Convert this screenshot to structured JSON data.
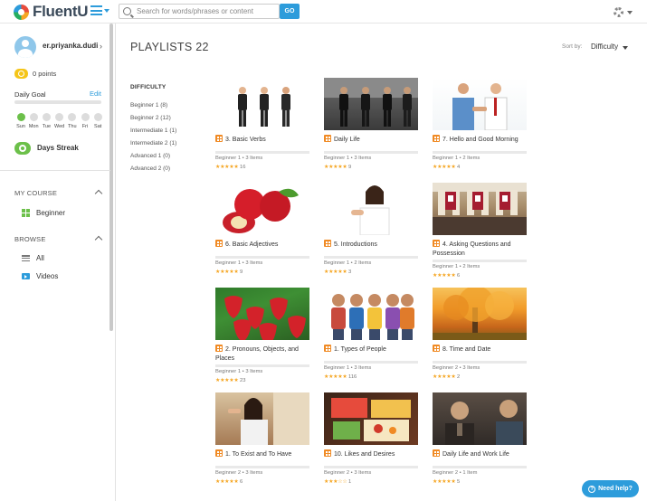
{
  "app": {
    "name": "FluentU"
  },
  "search": {
    "placeholder": "Search for words/phrases or content",
    "go_label": "GO"
  },
  "sidebar": {
    "username": "er.priyanka.dudi",
    "points": "0 points",
    "daily_goal_label": "Daily Goal",
    "edit_label": "Edit",
    "goal_progress": 0,
    "days": [
      "Sun",
      "Mon",
      "Tue",
      "Wed",
      "Thu",
      "Fri",
      "Sat"
    ],
    "active_day_index": 0,
    "streak_label": "Days Streak",
    "my_course_label": "MY COURSE",
    "course_item": "Beginner",
    "browse_label": "BROWSE",
    "browse_items": [
      "All",
      "Videos"
    ]
  },
  "main": {
    "title": "PLAYLISTS 22",
    "sort_label": "Sort by:",
    "sort_value": "Difficulty",
    "filters": {
      "heading": "DIFFICULTY",
      "items": [
        "Beginner 1 (8)",
        "Beginner 2 (12)",
        "Intermediate 1 (1)",
        "Intermediate 2 (1)",
        "Advanced 1 (0)",
        "Advanced 2 (0)"
      ]
    },
    "cards": [
      {
        "title": "3. Basic Verbs",
        "level": "Beginner 1",
        "items": "3 Items",
        "rating": 5,
        "reviews": "16"
      },
      {
        "title": "Daily Life",
        "level": "Beginner 1",
        "items": "3 Items",
        "rating": 5,
        "reviews": "9"
      },
      {
        "title": "7. Hello and Good Morning",
        "level": "Beginner 1",
        "items": "2 Items",
        "rating": 5,
        "reviews": "4"
      },
      {
        "title": "6. Basic Adjectives",
        "level": "Beginner 1",
        "items": "3 Items",
        "rating": 5,
        "reviews": "9"
      },
      {
        "title": "5. Introductions",
        "level": "Beginner 1",
        "items": "2 Items",
        "rating": 5,
        "reviews": "3"
      },
      {
        "title": "4. Asking Questions and Possession",
        "level": "Beginner 1",
        "items": "2 Items",
        "rating": 5,
        "reviews": "6"
      },
      {
        "title": "2. Pronouns, Objects, and Places",
        "level": "Beginner 1",
        "items": "3 Items",
        "rating": 5,
        "reviews": "23"
      },
      {
        "title": "1. Types of People",
        "level": "Beginner 1",
        "items": "3 Items",
        "rating": 5,
        "reviews": "116"
      },
      {
        "title": "8. Time and Date",
        "level": "Beginner 2",
        "items": "3 Items",
        "rating": 5,
        "reviews": "2"
      },
      {
        "title": "1. To Exist and To Have",
        "level": "Beginner 2",
        "items": "3 Items",
        "rating": 5,
        "reviews": "6"
      },
      {
        "title": "10. Likes and Desires",
        "level": "Beginner 2",
        "items": "3 Items",
        "rating": 3,
        "reviews": "1"
      },
      {
        "title": "Daily Life and Work Life",
        "level": "Beginner 2",
        "items": "1 Item",
        "rating": 5,
        "reviews": "5"
      }
    ]
  },
  "help": {
    "label": "Need help?"
  },
  "colors": {
    "brand": "#2d9cdb",
    "accent_green": "#6cc04a",
    "card_icon": "#f08a24",
    "star": "#f5a623"
  }
}
